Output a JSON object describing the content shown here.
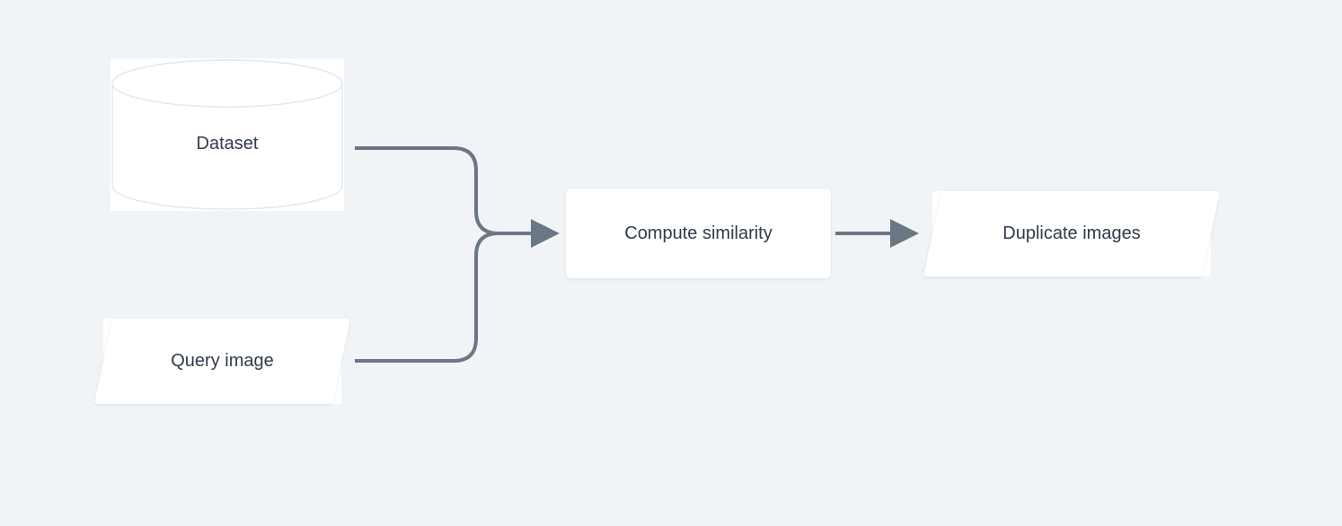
{
  "diagram": {
    "nodes": {
      "dataset": {
        "label": "Dataset",
        "shape": "cylinder"
      },
      "query": {
        "label": "Query image",
        "shape": "parallelogram"
      },
      "compute": {
        "label": "Compute similarity",
        "shape": "rectangle"
      },
      "output": {
        "label": "Duplicate images",
        "shape": "parallelogram"
      }
    },
    "edges": [
      {
        "from": "dataset",
        "to": "compute"
      },
      {
        "from": "query",
        "to": "compute"
      },
      {
        "from": "compute",
        "to": "output"
      }
    ],
    "style": {
      "background": "#f1f4f7",
      "node_fill": "#ffffff",
      "text_color": "#2f3b4a",
      "connector_color": "#6b7785"
    }
  }
}
